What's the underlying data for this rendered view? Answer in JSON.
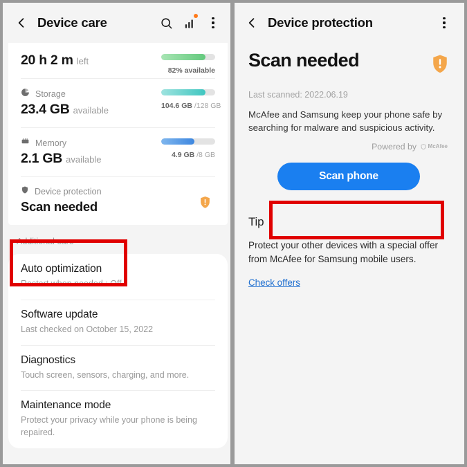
{
  "left_screen": {
    "appbar": {
      "back_icon": "chevron-left-icon",
      "title": "Device care",
      "search_icon": "search-icon",
      "stats_icon": "bar-chart-icon",
      "more_icon": "more-vertical-icon"
    },
    "battery_row": {
      "value": "20 h 2 m",
      "suffix": "left",
      "caption": "82% available",
      "percent": 82,
      "bar_color": "#6fcf85"
    },
    "storage_row": {
      "icon": "storage-pie-icon",
      "label": "Storage",
      "value": "23.4 GB",
      "suffix": "available",
      "used": "104.6 GB",
      "total": "/128 GB",
      "percent": 82,
      "bar_color": "#55cfc9"
    },
    "memory_row": {
      "icon": "memory-chip-icon",
      "label": "Memory",
      "value": "2.1 GB",
      "suffix": "available",
      "used": "4.9 GB",
      "total": "/8 GB",
      "percent": 61,
      "bar_color": "#4a90e2"
    },
    "protection_row": {
      "icon": "shield-icon",
      "label": "Device protection",
      "status": "Scan needed",
      "status_icon": "shield-alert-icon",
      "status_icon_color": "#f4a64a"
    },
    "section_label": "Additional care",
    "items": [
      {
        "title": "Auto optimization",
        "desc": "Restart when needed : Off"
      },
      {
        "title": "Software update",
        "desc": "Last checked on October 15, 2022"
      },
      {
        "title": "Diagnostics",
        "desc": "Touch screen, sensors, charging, and more."
      },
      {
        "title": "Maintenance mode",
        "desc": "Protect your privacy while your phone is being repaired."
      }
    ]
  },
  "right_screen": {
    "appbar": {
      "back_icon": "chevron-left-icon",
      "title": "Device protection",
      "more_icon": "more-vertical-icon"
    },
    "heading": "Scan needed",
    "heading_icon": "shield-alert-icon",
    "last_scanned": "Last scanned: 2022.06.19",
    "description": "McAfee and Samsung keep your phone safe by searching for malware and suspicious activity.",
    "powered_by_label": "Powered by",
    "powered_by_brand": "McAfee",
    "scan_button": "Scan phone",
    "tip_heading": "Tip",
    "tip_body": "Protect your other devices with a special offer from McAfee for Samsung mobile users.",
    "tip_link": "Check offers"
  },
  "annotations": {
    "highlight_color": "#e00000",
    "boxes": [
      {
        "name": "device-protection-highlight",
        "target": "Scan needed"
      },
      {
        "name": "scan-phone-highlight",
        "target": "Scan phone"
      }
    ]
  }
}
